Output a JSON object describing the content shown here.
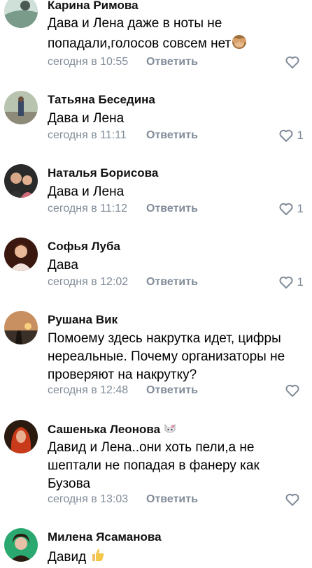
{
  "comments": [
    {
      "author": "Карина Римова",
      "text": "Дава и Лена даже в ноты не попадали,голосов совсем нет",
      "emoji": "see-no-evil-monkey",
      "time": "сегодня в 10:55",
      "reply": "Ответить",
      "likes": ""
    },
    {
      "author": "Татьяна Беседина",
      "text": "Дава и Лена",
      "time": "сегодня в 11:11",
      "reply": "Ответить",
      "likes": "1"
    },
    {
      "author": "Наталья Борисова",
      "text": "Дава и Лена",
      "time": "сегодня в 11:12",
      "reply": "Ответить",
      "likes": "1"
    },
    {
      "author": "Софья Луба",
      "text": "Дава",
      "time": "сегодня в 12:02",
      "reply": "Ответить",
      "likes": "1"
    },
    {
      "author": "Рушана Вик",
      "text": "Помоему здесь накрутка идет, цифры\nнереальные. Почему организаторы не\nпроверяют на накрутку?",
      "time": "сегодня в 12:48",
      "reply": "Ответить",
      "likes": ""
    },
    {
      "author": "Сашенька Леонова",
      "author_emoji": "cat-icon",
      "text": "Давид и Лена..они хоть пели,а не\nшептали не попадая в фанеру как\nБузова",
      "time": "сегодня в 13:03",
      "reply": "Ответить",
      "likes": ""
    },
    {
      "author": "Милена Ясаманова",
      "text": "Давид",
      "emoji": "thumbs-up",
      "time": "",
      "reply": "",
      "likes": ""
    }
  ],
  "colors": {
    "meta": "#818c99",
    "text": "#000000",
    "background": "#ffffff"
  }
}
